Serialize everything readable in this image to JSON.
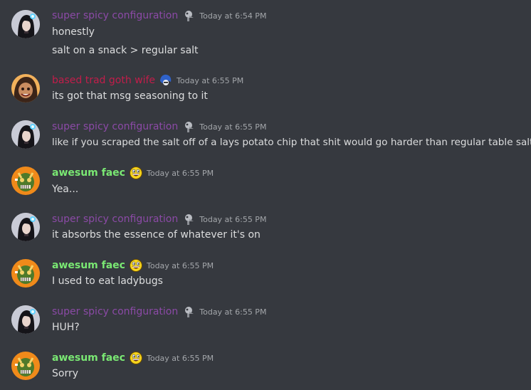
{
  "messages": [
    {
      "author": "super spicy configuration",
      "timestamp": "Today at 6:54 PM",
      "avatar_icon": "goth-girl-avatar",
      "badge_icon": "bird-skull-icon",
      "lines": [
        "honestly",
        "salt on a snack > regular salt"
      ]
    },
    {
      "author": "based trad goth wife",
      "timestamp": "Today at 6:55 PM",
      "avatar_icon": "cartoon-girl-avatar",
      "badge_icon": "blue-hair-icon",
      "lines": [
        "its got that msg seasoning to it"
      ]
    },
    {
      "author": "super spicy configuration",
      "timestamp": "Today at 6:55 PM",
      "avatar_icon": "goth-girl-avatar",
      "badge_icon": "bird-skull-icon",
      "lines": [
        "like if you scraped the salt off of a lays potato chip that shit would go harder than regular table salt"
      ]
    },
    {
      "author": "awesum faec",
      "timestamp": "Today at 6:55 PM",
      "avatar_icon": "green-creature-avatar",
      "badge_icon": "awesome-face-icon",
      "lines": [
        "Yea..."
      ]
    },
    {
      "author": "super spicy configuration",
      "timestamp": "Today at 6:55 PM",
      "avatar_icon": "goth-girl-avatar",
      "badge_icon": "bird-skull-icon",
      "lines": [
        "it absorbs the essence of whatever it's on"
      ]
    },
    {
      "author": "awesum faec",
      "timestamp": "Today at 6:55 PM",
      "avatar_icon": "green-creature-avatar",
      "badge_icon": "awesome-face-icon",
      "lines": [
        "I used to eat ladybugs"
      ]
    },
    {
      "author": "super spicy configuration",
      "timestamp": "Today at 6:55 PM",
      "avatar_icon": "goth-girl-avatar",
      "badge_icon": "bird-skull-icon",
      "lines": [
        "HUH?"
      ]
    },
    {
      "author": "awesum faec",
      "timestamp": "Today at 6:55 PM",
      "avatar_icon": "green-creature-avatar",
      "badge_icon": "awesome-face-icon",
      "lines": [
        "Sorry"
      ]
    }
  ],
  "colors": {
    "background": "#36393f",
    "message_text": "#dcddde",
    "timestamp": "#a3a6aa",
    "super_spicy_name": "#8b4aa6",
    "goth_wife_name": "#c21d4a",
    "awesum_faec_name": "#7ae873"
  }
}
